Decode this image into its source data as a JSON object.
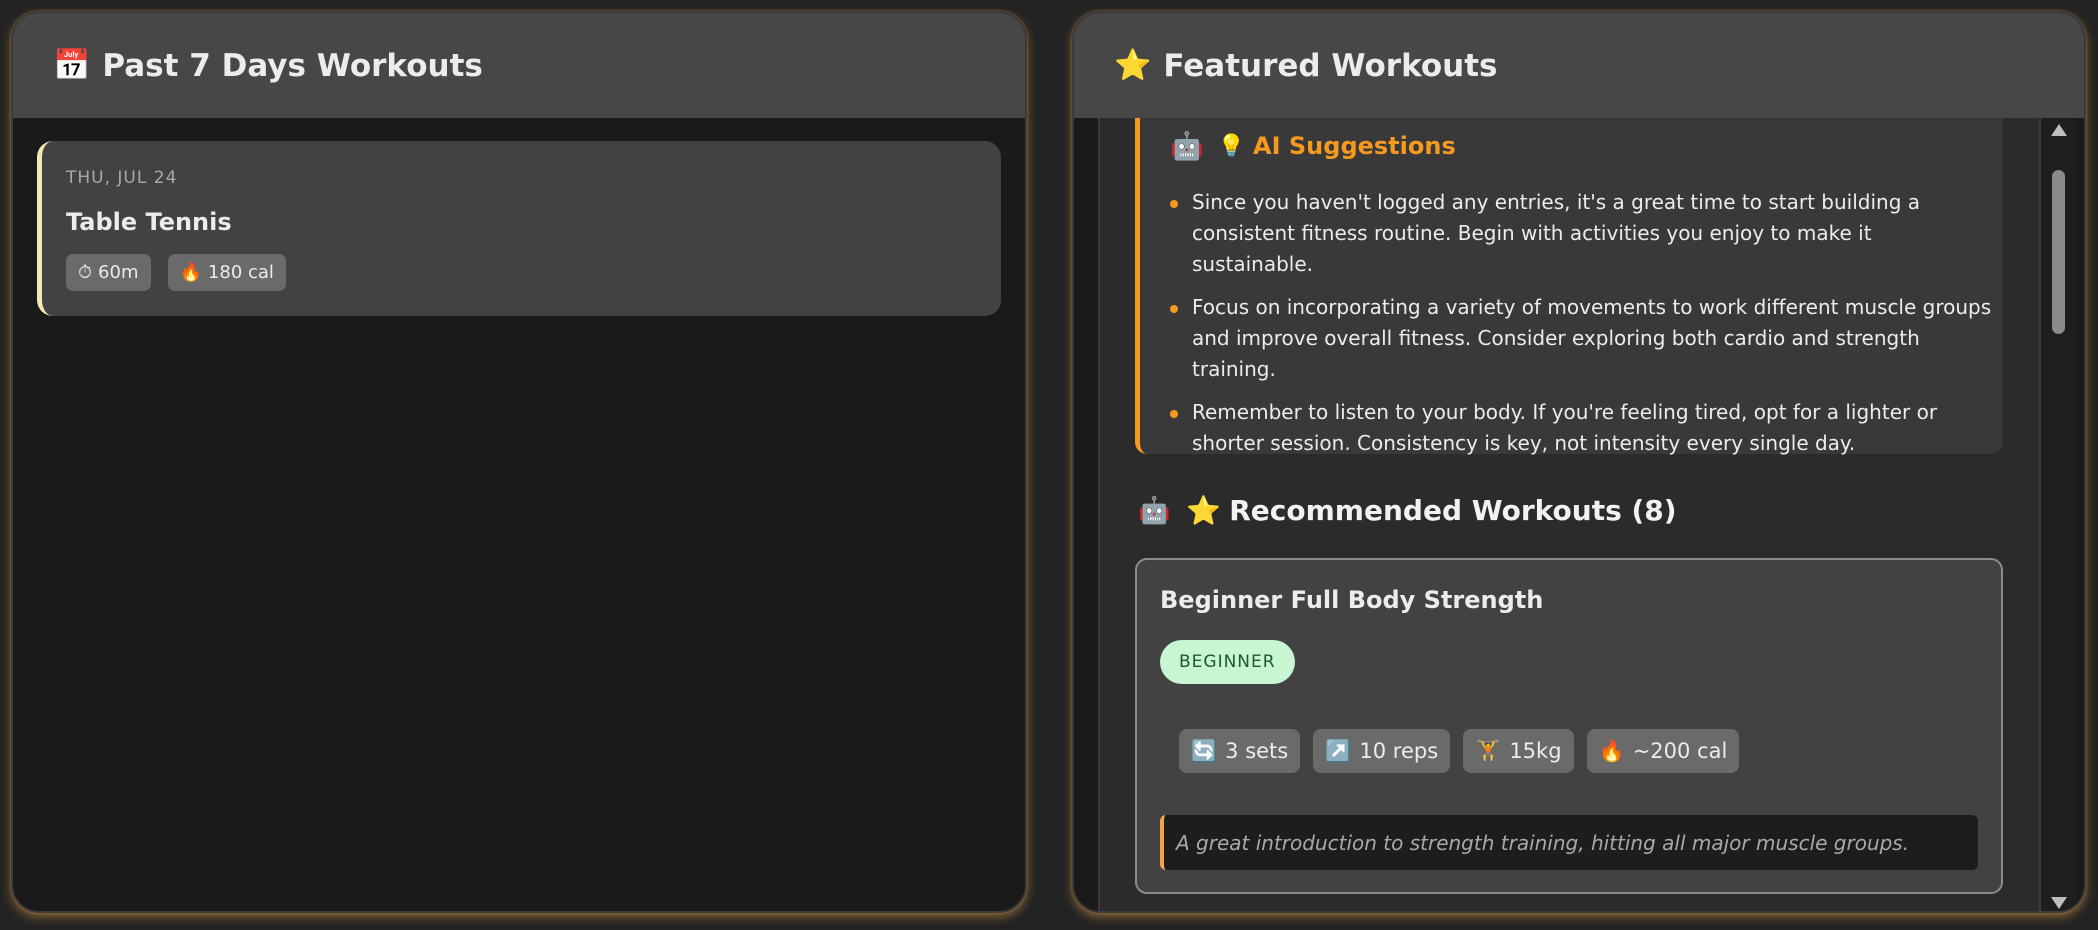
{
  "left_panel": {
    "icon": "calendar-icon",
    "icon_glyph": "📅",
    "title": "Past 7 Days Workouts",
    "workouts": [
      {
        "date": "THU, JUL 24",
        "name": "Table Tennis",
        "duration_icon": "⏱",
        "duration": "60m",
        "calories_icon": "🔥",
        "calories": "180 cal"
      }
    ]
  },
  "right_panel": {
    "icon": "star-icon",
    "icon_glyph": "⭐",
    "title": "Featured Workouts",
    "ai_suggestions": {
      "robot_glyph": "🤖",
      "bulb_glyph": "💡",
      "title": "AI Suggestions",
      "items": [
        "Since you haven't logged any entries, it's a great time to start building a consistent fitness routine. Begin with activities you enjoy to make it sustainable.",
        "Focus on incorporating a variety of movements to work different muscle groups and improve overall fitness. Consider exploring both cardio and strength training.",
        "Remember to listen to your body. If you're feeling tired, opt for a lighter or shorter session. Consistency is key, not intensity every single day."
      ]
    },
    "recommended": {
      "robot_glyph": "🤖",
      "star_glyph": "⭐",
      "title": "Recommended Workouts (8)",
      "cards": [
        {
          "title": "Beginner Full Body Strength",
          "level": "BEGINNER",
          "sets_icon": "🔄",
          "sets": "3 sets",
          "reps_icon": "↗️",
          "reps": "10 reps",
          "weight_icon": "🏋️",
          "weight": "15kg",
          "calories_icon": "🔥",
          "calories": "~200 cal",
          "description": "A great introduction to strength training, hitting all major muscle groups."
        }
      ]
    }
  },
  "colors": {
    "accent_orange": "#f59a1f",
    "badge_green_bg": "#c8f5d2",
    "card_border_left": "#f3e9b5"
  }
}
